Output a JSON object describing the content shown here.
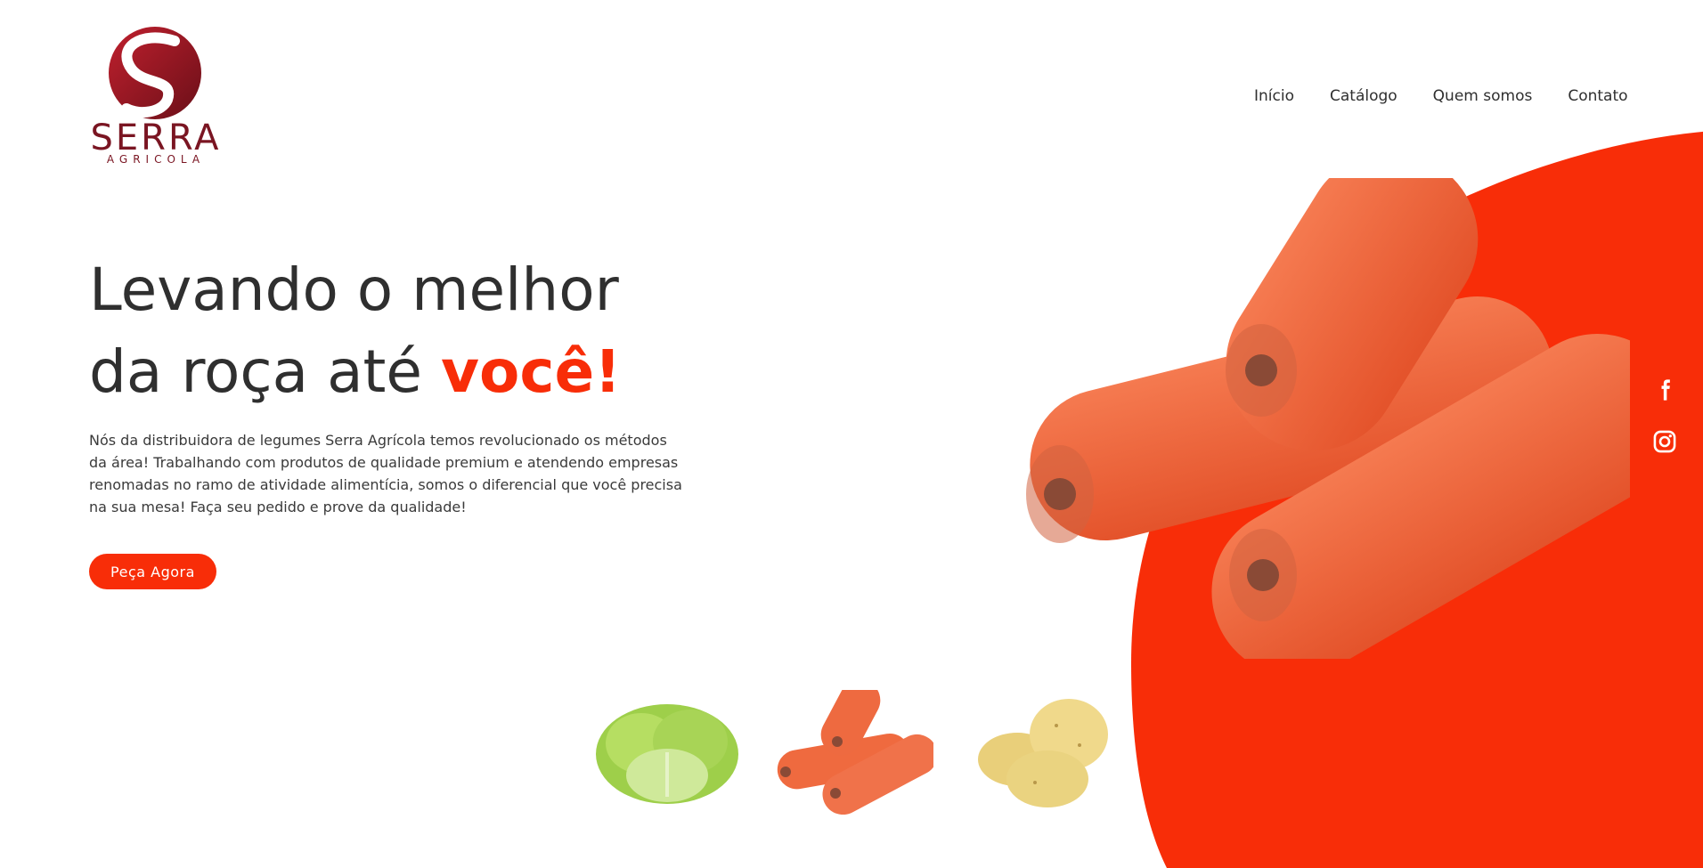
{
  "brand": {
    "name": "SERRA",
    "sub": "AGRICOLA"
  },
  "nav": [
    {
      "label": "Início"
    },
    {
      "label": "Catálogo"
    },
    {
      "label": "Quem somos"
    },
    {
      "label": "Contato"
    }
  ],
  "hero": {
    "title_line1": "Levando o melhor",
    "title_line2": "da roça até ",
    "title_accent": "você!",
    "description": "Nós da distribuidora de legumes Serra Agrícola temos revolucionado os métodos da área! Trabalhando com produtos de qualidade premium e atendendo empresas renomadas no ramo de atividade alimentícia, somos o diferencial que você precisa na sua mesa! Faça seu pedido e prove da qualidade!",
    "cta_label": "Peça Agora"
  },
  "social": [
    {
      "icon": "facebook-icon"
    },
    {
      "icon": "instagram-icon"
    }
  ],
  "products": [
    {
      "icon": "lettuce-icon"
    },
    {
      "icon": "carrots-icon"
    },
    {
      "icon": "potatoes-icon"
    }
  ],
  "colors": {
    "accent": "#f82d08",
    "brand": "#7a1522",
    "text": "#2f2f2f"
  }
}
